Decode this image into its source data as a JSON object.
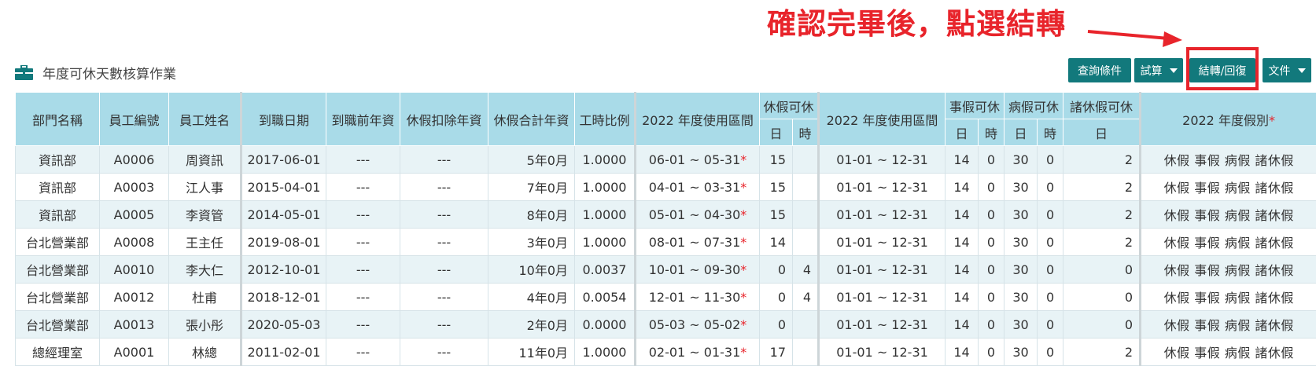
{
  "annotation": "確認完畢後，點選結轉",
  "page_title": "年度可休天數核算作業",
  "toolbar": {
    "query_label": "查詢條件",
    "trial_label": "試算",
    "transfer_label": "結轉/回復",
    "doc_label": "文件"
  },
  "headers": {
    "dept": "部門名稱",
    "emp_no": "員工編號",
    "emp_name": "員工姓名",
    "hire_date": "到職日期",
    "prior_seniority": "到職前年資",
    "leave_deduct": "休假扣除年資",
    "leave_total": "休假合計年資",
    "hour_ratio": "工時比例",
    "period1": "2022 年度使用區間",
    "annual_leave": "休假可休",
    "day": "日",
    "hour": "時",
    "period2": "2022 年度使用區間",
    "personal_leave": "事假可休",
    "sick_leave": "病假可休",
    "other_leave": "諸休假可休",
    "leave_types": "2022 年度假別"
  },
  "required_star": "*",
  "leave_labels": "休假 事假 病假 諸休假",
  "rows": [
    {
      "dept": "資訊部",
      "no": "A0006",
      "name": "周資訊",
      "hire": "2017-06-01",
      "prior": "---",
      "deduct": "---",
      "total": "5年0月",
      "ratio": "1.0000",
      "p1": "06-01 ~ 05-31",
      "ad": "15",
      "ah": "",
      "p2": "01-01 ~ 12-31",
      "pd": "14",
      "ph": "0",
      "sd": "30",
      "sh": "0",
      "od": "2"
    },
    {
      "dept": "資訊部",
      "no": "A0003",
      "name": "江人事",
      "hire": "2015-04-01",
      "prior": "---",
      "deduct": "---",
      "total": "7年0月",
      "ratio": "1.0000",
      "p1": "04-01 ~ 03-31",
      "ad": "15",
      "ah": "",
      "p2": "01-01 ~ 12-31",
      "pd": "14",
      "ph": "0",
      "sd": "30",
      "sh": "0",
      "od": "2"
    },
    {
      "dept": "資訊部",
      "no": "A0005",
      "name": "李資管",
      "hire": "2014-05-01",
      "prior": "---",
      "deduct": "---",
      "total": "8年0月",
      "ratio": "1.0000",
      "p1": "05-01 ~ 04-30",
      "ad": "15",
      "ah": "",
      "p2": "01-01 ~ 12-31",
      "pd": "14",
      "ph": "0",
      "sd": "30",
      "sh": "0",
      "od": "2"
    },
    {
      "dept": "台北營業部",
      "no": "A0008",
      "name": "王主任",
      "hire": "2019-08-01",
      "prior": "---",
      "deduct": "---",
      "total": "3年0月",
      "ratio": "1.0000",
      "p1": "08-01 ~ 07-31",
      "ad": "14",
      "ah": "",
      "p2": "01-01 ~ 12-31",
      "pd": "14",
      "ph": "0",
      "sd": "30",
      "sh": "0",
      "od": "2"
    },
    {
      "dept": "台北營業部",
      "no": "A0010",
      "name": "李大仁",
      "hire": "2012-10-01",
      "prior": "---",
      "deduct": "---",
      "total": "10年0月",
      "ratio": "0.0037",
      "p1": "10-01 ~ 09-30",
      "ad": "0",
      "ah": "4",
      "p2": "01-01 ~ 12-31",
      "pd": "14",
      "ph": "0",
      "sd": "30",
      "sh": "0",
      "od": "0"
    },
    {
      "dept": "台北營業部",
      "no": "A0012",
      "name": "杜甫",
      "hire": "2018-12-01",
      "prior": "---",
      "deduct": "---",
      "total": "4年0月",
      "ratio": "0.0054",
      "p1": "12-01 ~ 11-30",
      "ad": "0",
      "ah": "4",
      "p2": "01-01 ~ 12-31",
      "pd": "14",
      "ph": "0",
      "sd": "30",
      "sh": "0",
      "od": "0"
    },
    {
      "dept": "台北營業部",
      "no": "A0013",
      "name": "張小彤",
      "hire": "2020-05-03",
      "prior": "---",
      "deduct": "---",
      "total": "2年0月",
      "ratio": "0.0000",
      "p1": "05-03 ~ 05-02",
      "ad": "0",
      "ah": "",
      "p2": "01-01 ~ 12-31",
      "pd": "14",
      "ph": "0",
      "sd": "30",
      "sh": "0",
      "od": "0"
    },
    {
      "dept": "總經理室",
      "no": "A0001",
      "name": "林總",
      "hire": "2011-02-01",
      "prior": "---",
      "deduct": "---",
      "total": "11年0月",
      "ratio": "1.0000",
      "p1": "02-01 ~ 01-31",
      "ad": "17",
      "ah": "",
      "p2": "01-01 ~ 12-31",
      "pd": "14",
      "ph": "0",
      "sd": "30",
      "sh": "0",
      "od": "2"
    }
  ]
}
